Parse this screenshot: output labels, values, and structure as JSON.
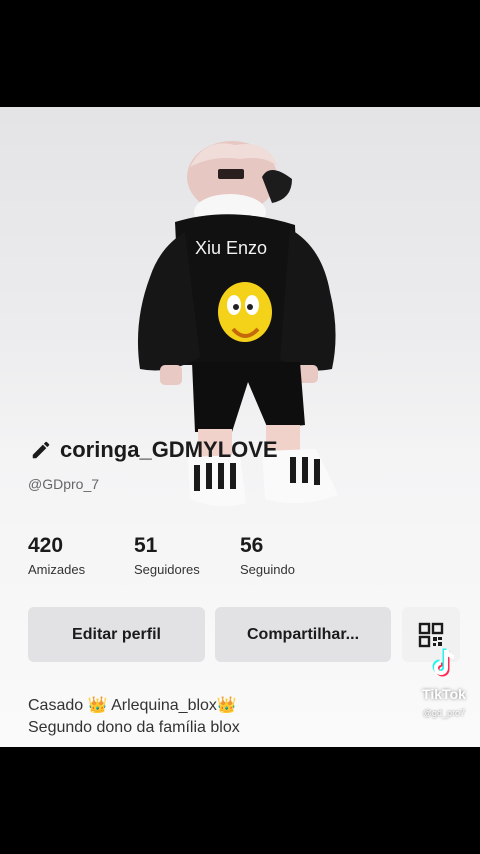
{
  "profile": {
    "display_name": "coringa_GDMYLOVE",
    "handle": "@GDpro_7",
    "shirt_text": "Xiu Enzo"
  },
  "stats": [
    {
      "value": "420",
      "label": "Amizades"
    },
    {
      "value": "51",
      "label": "Seguidores"
    },
    {
      "value": "56",
      "label": "Seguindo"
    }
  ],
  "actions": {
    "edit_label": "Editar perfil",
    "share_label": "Compartilhar...",
    "qr_icon": "qr-code-icon"
  },
  "bio": {
    "line1": "Casado 👑 Arlequina_blox👑",
    "line2": "Segundo dono da família blox"
  },
  "watermark": {
    "brand": "TikTok",
    "user": "@gd_pro7"
  },
  "colors": {
    "button_bg": "#e2e2e4",
    "text": "#1b1b1b",
    "background_top": "#e4e4e6"
  }
}
